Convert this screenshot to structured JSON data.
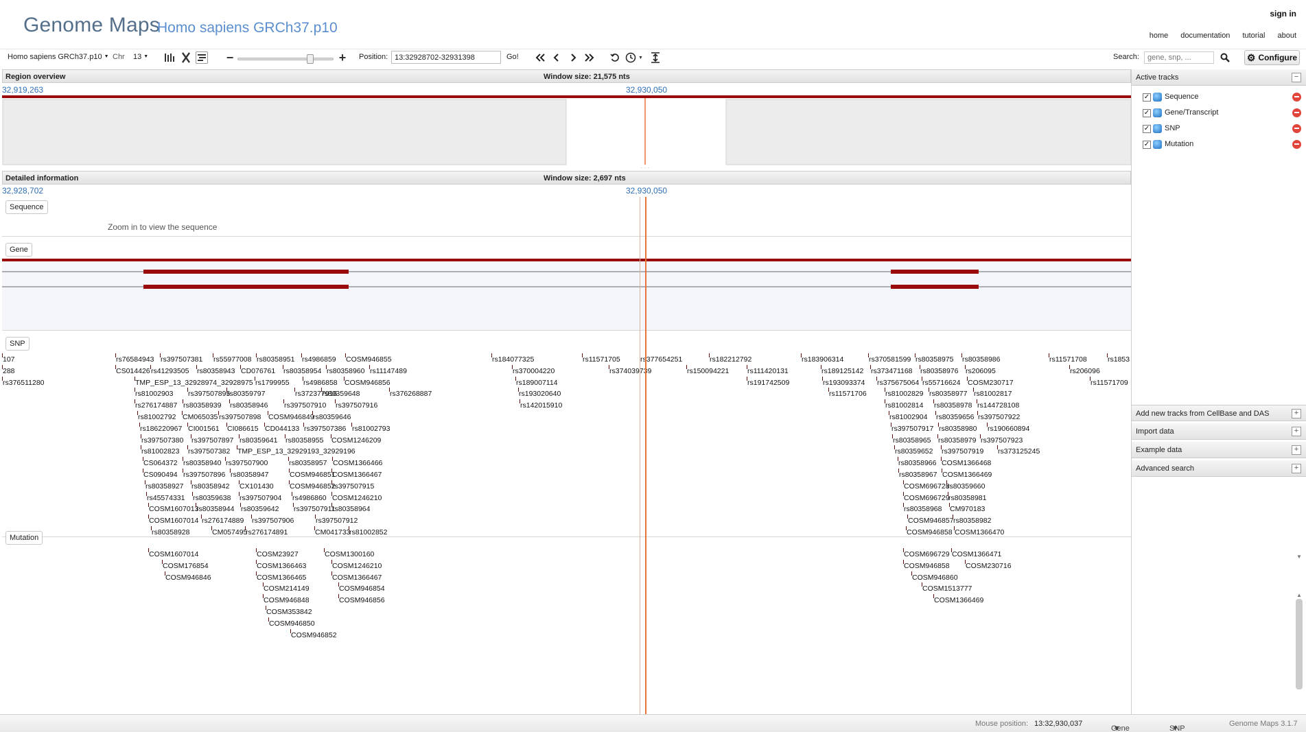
{
  "header": {
    "app_title": "Genome Maps",
    "species_title": "Homo sapiens GRCh37.p10",
    "sign_in": "sign in",
    "links": [
      "home",
      "documentation",
      "tutorial",
      "about"
    ]
  },
  "toolbar": {
    "species_select": "Homo sapiens GRCh37.p10",
    "chr_label": "Chr",
    "chr_value": "13",
    "position_label": "Position:",
    "position_value": "13:32928702-32931398",
    "go_label": "Go!",
    "search_label": "Search:",
    "search_placeholder": "gene, snp, ...",
    "configure_label": "Configure",
    "zoom_level_percent": 76
  },
  "region_overview": {
    "title": "Region overview",
    "window_size": "Window size: 21,575 nts",
    "left_coord": "32,919,263",
    "center_coord": "32,930,050"
  },
  "detailed": {
    "title": "Detailed information",
    "window_size": "Window size: 2,697 nts",
    "left_coord": "32,928,702",
    "center_coord": "32,930,050"
  },
  "tracks": {
    "sequence": {
      "label": "Sequence",
      "message": "Zoom in to view the sequence"
    },
    "gene": {
      "label": "Gene"
    },
    "snp": {
      "label": "SNP",
      "rows": [
        [
          "107",
          "rs76584943",
          "rs397507381",
          "rs55977008",
          "rs80358951",
          "rs4986859",
          "COSM946855",
          "rs184077325",
          "rs11571705",
          "rs377654251",
          "rs182212792",
          "rs183906314",
          "rs370581599",
          "rs80358975",
          "rs80358986",
          "rs11571708",
          "rs1853"
        ],
        [
          "288",
          "CS014426",
          "rs41293505",
          "rs80358943",
          "CD076761",
          "rs80358954",
          "rs80358960",
          "rs11147489",
          "rs370004220",
          "rs374039739",
          "rs150094221",
          "rs111420131",
          "rs189125142",
          "rs373471168",
          "rs80358976",
          "rs206095",
          "rs206096"
        ],
        [
          "rs376511280",
          "TMP_ESP_13_32928974_32928975",
          "rs1799955",
          "rs4986858",
          "COSM946856",
          "rs189007114",
          "rs191742509",
          "rs193093374",
          "rs375675064",
          "rs55716624",
          "COSM230717",
          "rs11571709"
        ],
        [
          "rs81002903",
          "rs397507895",
          "rs80359797",
          "rs372377916",
          "rs80359648",
          "rs376268887",
          "rs193020640",
          "rs11571706",
          "rs81002829",
          "rs80358977",
          "rs81002817"
        ],
        [
          "rs276174887",
          "rs80358939",
          "rs80358946",
          "rs397507910",
          "rs397507916",
          "rs142015910",
          "rs81002814",
          "rs80358978",
          "rs144728108"
        ],
        [
          "rs81002792",
          "CM065035",
          "rs397507898",
          "COSM946849",
          "rs80359646",
          "rs81002904",
          "rs80359656",
          "rs397507922"
        ],
        [
          "rs186220967",
          "CI001561",
          "CI086615",
          "CD044133",
          "rs397507386",
          "rs81002793",
          "rs397507917",
          "rs80358980",
          "rs190660894"
        ],
        [
          "rs397507380",
          "rs397507897",
          "rs80359641",
          "rs80358955",
          "COSM1246209",
          "rs80358965",
          "rs80358979",
          "rs397507923"
        ],
        [
          "rs81002823",
          "rs397507382",
          "TMP_ESP_13_32929193_32929196",
          "rs80359652",
          "rs397507919",
          "rs373125245"
        ],
        [
          "CS064372",
          "rs80358940",
          "rs397507900",
          "rs80358957",
          "COSM1366466",
          "rs80358966",
          "COSM1366468"
        ],
        [
          "CS090494",
          "rs397507896",
          "rs80358947",
          "COSM946851",
          "COSM1366467",
          "rs80358967",
          "COSM1366469"
        ],
        [
          "rs80358927",
          "rs80358942",
          "CX101430",
          "COSM946852",
          "rs397507915",
          "COSM696728",
          "rs80359660"
        ],
        [
          "rs45574331",
          "rs80359638",
          "rs397507904",
          "rs4986860",
          "COSM1246210",
          "COSM696729",
          "rs80358981"
        ],
        [
          "COSM1607013",
          "rs80358944",
          "rs80359642",
          "rs397507911",
          "rs80358964",
          "rs80358968",
          "CM970183"
        ],
        [
          "COSM1607014",
          "rs276174889",
          "rs397507906",
          "rs397507912",
          "COSM946857",
          "rs80358982"
        ],
        [
          "rs80358928",
          "CM057495",
          "rs276174891",
          "CM041733",
          "rs81002852",
          "COSM946858",
          "COSM1366470"
        ]
      ]
    },
    "mutation": {
      "label": "Mutation",
      "rows": [
        [
          "COSM1607014",
          "COSM23927",
          "COSM1300160",
          "COSM696729",
          "COSM1366471"
        ],
        [
          "COSM176854",
          "COSM1366463",
          "COSM1246210",
          "COSM946858",
          "COSM230716"
        ],
        [
          "COSM946846",
          "COSM1366465",
          "COSM1366467",
          "COSM946860"
        ],
        [
          "COSM214149",
          "COSM946854",
          "COSM1513777"
        ],
        [
          "COSM946848",
          "COSM946856",
          "COSM1366469"
        ],
        [
          "COSM353842"
        ],
        [
          "COSM946850"
        ],
        [
          "COSM946852"
        ]
      ]
    }
  },
  "right_panel": {
    "active_tracks_title": "Active tracks",
    "active_tracks": [
      "Sequence",
      "Gene/Transcript",
      "SNP",
      "Mutation"
    ],
    "sections": [
      "Add new tracks from CellBase and DAS",
      "Import data",
      "Example data",
      "Advanced search"
    ]
  },
  "status": {
    "mouse_label": "Mouse position:",
    "mouse_value": "13:32,930,037",
    "gene_legend": "Gene legend",
    "snp_legend": "SNP legend",
    "version": "Genome Maps 3.1.7"
  },
  "colors": {
    "feature_red": "#9b0a0a",
    "cursor_orange": "#e8743b",
    "link_blue": "#2f6fb5",
    "title_slate": "#546f8a"
  }
}
